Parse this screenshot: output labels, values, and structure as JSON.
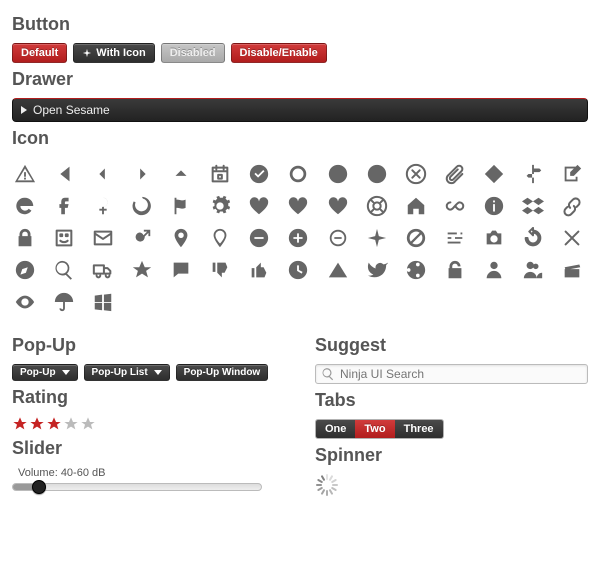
{
  "sections": {
    "button": "Button",
    "drawer": "Drawer",
    "icon": "Icon",
    "popup": "Pop-Up",
    "suggest": "Suggest",
    "rating": "Rating",
    "tabs": "Tabs",
    "slider": "Slider",
    "spinner": "Spinner"
  },
  "buttons": {
    "default": "Default",
    "with_icon": "With Icon",
    "disabled": "Disabled",
    "disable_enable": "Disable/Enable"
  },
  "drawer": {
    "label": "Open Sesame"
  },
  "icons": [
    "alert",
    "caret-left-solid",
    "caret-left",
    "caret-right",
    "caret-up",
    "calendar",
    "check-circle",
    "circle",
    "target",
    "circle-solid",
    "x-circle",
    "paperclip",
    "diamond",
    "signpost",
    "edit-box",
    "ie",
    "facebook",
    "female",
    "firefox",
    "flag",
    "gear",
    "heart",
    "heart-plus",
    "heart-minus",
    "lifebuoy",
    "home",
    "infinity",
    "info",
    "dropbox",
    "link",
    "lock",
    "finder",
    "mail",
    "male",
    "marker",
    "marker-outline",
    "minus-circle-solid",
    "plus-circle-solid",
    "minus-circle",
    "shuriken",
    "no-entry",
    "sliders",
    "camera",
    "refresh",
    "x",
    "compass",
    "search",
    "truck",
    "star",
    "chat",
    "thumbs-down",
    "thumbs-up",
    "clock",
    "triangle",
    "twitter",
    "ubuntu",
    "unlock",
    "user",
    "users",
    "clapper",
    "eye",
    "umbrella",
    "windows"
  ],
  "popup": {
    "popup": "Pop-Up",
    "popup_list": "Pop-Up List",
    "popup_window": "Pop-Up Window"
  },
  "suggest": {
    "placeholder": "Ninja UI Search"
  },
  "rating": {
    "max": 5,
    "value": 3
  },
  "tabs": {
    "items": [
      "One",
      "Two",
      "Three"
    ],
    "active_index": 1
  },
  "slider": {
    "label_prefix": "Volume: ",
    "value_text": "40-60 dB"
  },
  "colors": {
    "accent": "#b11d1d",
    "icon": "#666666"
  }
}
